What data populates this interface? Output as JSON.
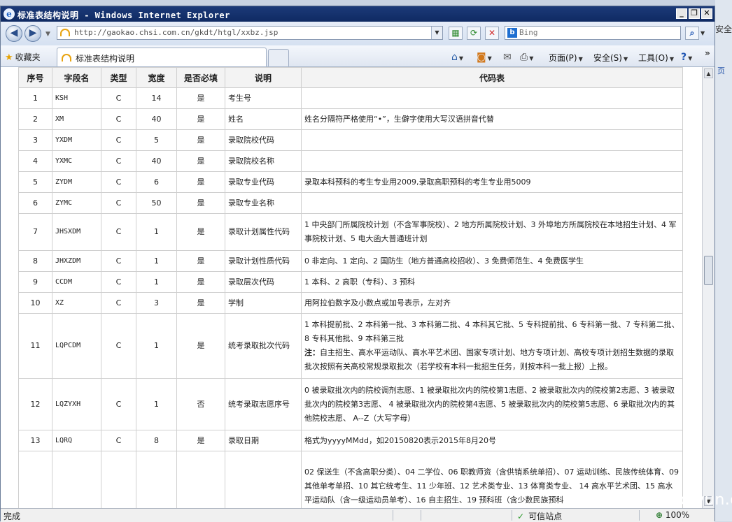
{
  "window": {
    "title": "标准表结构说明 - Windows Internet Explorer",
    "controls": {
      "minimize": "_",
      "restore": "❐",
      "close": "✕"
    }
  },
  "nav": {
    "back_glyph": "◀",
    "forward_glyph": "▶",
    "address": "http://gaokao.chsi.com.cn/gkdt/htgl/xxbz.jsp",
    "search_placeholder": "Bing"
  },
  "favorites_bar": {
    "favorites_label": "收藏夹",
    "tab_title": "标准表结构说明"
  },
  "command_bar": {
    "page_label": "页面(P)",
    "safety_label": "安全(S)",
    "tools_label": "工具(O)"
  },
  "table": {
    "headers": [
      "序号",
      "字段名",
      "类型",
      "宽度",
      "是否必填",
      "说明",
      "代码表"
    ],
    "rows": [
      {
        "no": "1",
        "field": "KSH",
        "type": "C",
        "width": "14",
        "required": "是",
        "desc": "考生号",
        "code": ""
      },
      {
        "no": "2",
        "field": "XM",
        "type": "C",
        "width": "40",
        "required": "是",
        "desc": "姓名",
        "code": "姓名分隔符严格使用“•”，生僻字使用大写汉语拼音代替"
      },
      {
        "no": "3",
        "field": "YXDM",
        "type": "C",
        "width": "5",
        "required": "是",
        "desc": "录取院校代码",
        "code": ""
      },
      {
        "no": "4",
        "field": "YXMC",
        "type": "C",
        "width": "40",
        "required": "是",
        "desc": "录取院校名称",
        "code": ""
      },
      {
        "no": "5",
        "field": "ZYDM",
        "type": "C",
        "width": "6",
        "required": "是",
        "desc": "录取专业代码",
        "code": "录取本科预科的考生专业用2009,录取高职预科的考生专业用5009"
      },
      {
        "no": "6",
        "field": "ZYMC",
        "type": "C",
        "width": "50",
        "required": "是",
        "desc": "录取专业名称",
        "code": ""
      },
      {
        "no": "7",
        "field": "JHSXDM",
        "type": "C",
        "width": "1",
        "required": "是",
        "desc": "录取计划属性代码",
        "code": "1 中央部门所属院校计划（不含军事院校）、2 地方所属院校计划、3 外埠地方所属院校在本地招生计划、4 军事院校计划、5 电大函大普通班计划"
      },
      {
        "no": "8",
        "field": "JHXZDM",
        "type": "C",
        "width": "1",
        "required": "是",
        "desc": "录取计划性质代码",
        "code": "0 非定向、1 定向、2 国防生（地方普通高校招收）、3 免费师范生、4 免费医学生"
      },
      {
        "no": "9",
        "field": "CCDM",
        "type": "C",
        "width": "1",
        "required": "是",
        "desc": "录取层次代码",
        "code": "1 本科、2 高职（专科）、3 预科"
      },
      {
        "no": "10",
        "field": "XZ",
        "type": "C",
        "width": "3",
        "required": "是",
        "desc": "学制",
        "code": "用阿拉伯数字及小数点或加号表示，左对齐"
      },
      {
        "no": "11",
        "field": "LQPCDM",
        "type": "C",
        "width": "1",
        "required": "是",
        "desc": "统考录取批次代码",
        "code": "1 本科提前批、2 本科第一批、3 本科第二批、4 本科其它批、5 专科提前批、6 专科第一批、7 专科第二批、8 专科其他批、9 本科第三批",
        "note_label": "注：",
        "note": "自主招生、高水平运动队、高水平艺术团、国家专项计划、地方专项计划、高校专项计划招生数据的录取批次按照有关高校常规录取批次（若学校有本科一批招生任务，则按本科一批上报）上报。"
      },
      {
        "no": "12",
        "field": "LQZYXH",
        "type": "C",
        "width": "1",
        "required": "否",
        "desc": "统考录取志愿序号",
        "code": "0 被录取批次内的院校调剂志愿、1 被录取批次内的院校第1志愿、2 被录取批次内的院校第2志愿、3 被录取批次内的院校第3志愿、 4 被录取批次内的院校第4志愿、5 被录取批次内的院校第5志愿、6 录取批次内的其他院校志愿、 A--Z（大写字母）"
      },
      {
        "no": "13",
        "field": "LQRQ",
        "type": "C",
        "width": "8",
        "required": "是",
        "desc": "录取日期",
        "code": "格式为yyyyMMdd，如20150820表示2015年8月20号"
      },
      {
        "no": "",
        "field": "",
        "type": "",
        "width": "",
        "required": "",
        "desc": "",
        "code": "02 保送生（不含高职分类）、04 二学位、06 职教师资（含供销系统单招）、07 运动训练、民族传统体育、09 其他单考单招、10 其它统考生、11 少年班、12 艺术类专业、13 体育类专业、 14 高水平艺术团、15 高水平运动队（含一级运动员单考）、16 自主招生、19 预科班（含少数民族预科"
      }
    ]
  },
  "status": {
    "left": "完成",
    "zone": "可信站点",
    "zoom": "100%"
  },
  "outside": {
    "security_fragment": "安全",
    "right_fragment": "页"
  },
  "watermark": "www.wooyun.org"
}
